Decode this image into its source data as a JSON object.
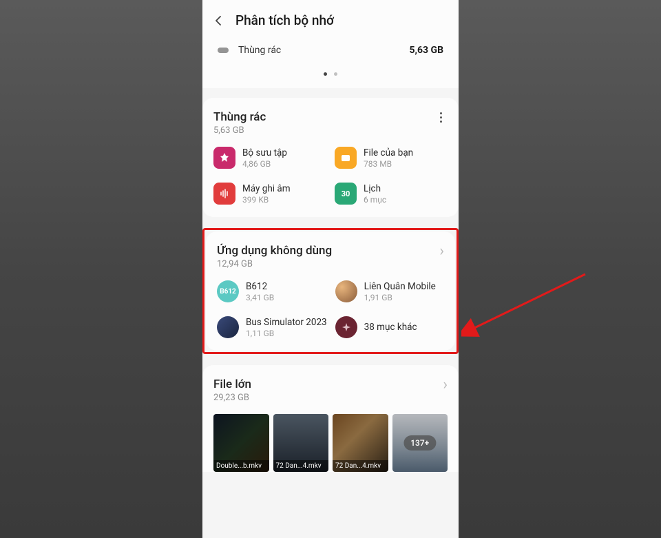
{
  "header": {
    "title": "Phân tích bộ nhớ"
  },
  "trash_summary": {
    "label": "Thùng rác",
    "size": "5,63 GB"
  },
  "card_trash": {
    "title": "Thùng rác",
    "subtitle": "5,63 GB",
    "items": [
      {
        "name": "Bộ sưu tập",
        "sub": "4,86 GB"
      },
      {
        "name": "File của bạn",
        "sub": "783 MB"
      },
      {
        "name": "Máy ghi âm",
        "sub": "399 KB"
      },
      {
        "name": "Lịch",
        "sub": "6 mục"
      }
    ]
  },
  "card_unused": {
    "title": "Ứng dụng không dùng",
    "subtitle": "12,94 GB",
    "items": [
      {
        "name": "B612",
        "sub": "3,41 GB"
      },
      {
        "name": "Liên Quân Mobile",
        "sub": "1,91 GB"
      },
      {
        "name": "Bus Simulator 2023",
        "sub": "1,11 GB"
      },
      {
        "name": "38 mục khác",
        "sub": ""
      }
    ]
  },
  "card_large": {
    "title": "File lớn",
    "subtitle": "29,23 GB",
    "thumbs": [
      {
        "label": "Double...b.mkv"
      },
      {
        "label": "72 Dan...4.mkv"
      },
      {
        "label": "72 Dan...4.mkv"
      },
      {
        "label": "",
        "badge": "137+"
      }
    ]
  },
  "icons": {
    "cal_day": "30",
    "b612": "B612"
  }
}
